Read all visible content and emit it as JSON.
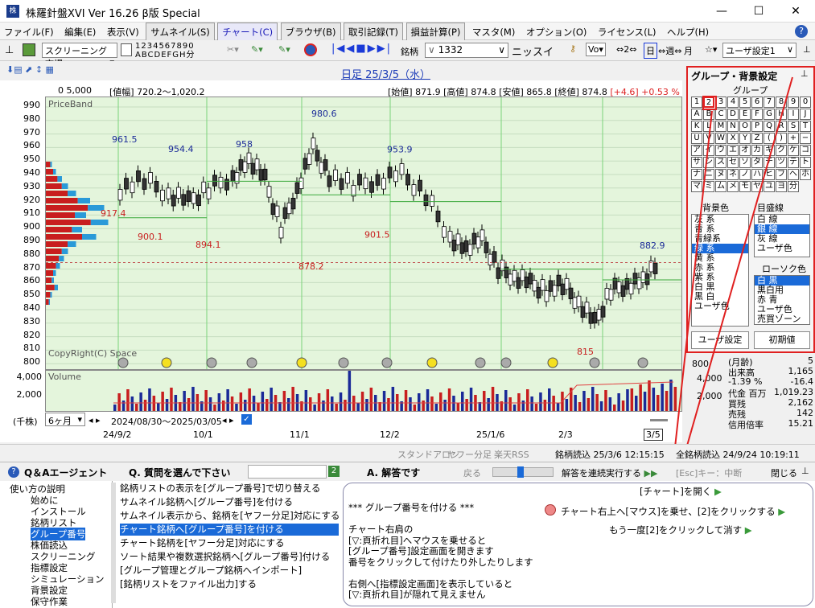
{
  "window": {
    "title": "株羅針盤XVI Ver 16.26 β版  Special",
    "icon": "app-icon"
  },
  "menu": [
    "ファイル(F)",
    "編集(E)",
    "表示(V)",
    "サムネイル(S)",
    "チャート(C)",
    "ブラウザ(B)",
    "取引記録(T)",
    "損益計算(P)",
    "マスタ(M)",
    "オプション(O)",
    "ライセンス(L)",
    "ヘルプ(H)"
  ],
  "toolbar": {
    "screening_combo": "スクリーニング市場",
    "digits_top": "1234567890",
    "digits_bottom": "ABCDEFGH分",
    "stock_label": "銘柄",
    "code": "1332",
    "name": "ニッスイ",
    "vo": "Vo",
    "two": "2",
    "day": "日",
    "week": "週",
    "month": "月",
    "user_setting": "ユーザ設定1"
  },
  "chart": {
    "date_title": "日足 25/3/5（水）",
    "scale_label": "0    5,000",
    "range_text": "[値幅] 720.2～1,020.2",
    "ohlc": {
      "open_label": "[始値]",
      "open": "871.9",
      "high_label": "[高値]",
      "high": "874.8",
      "low_label": "[安値]",
      "low": "865.8",
      "close_label": "[終値]",
      "close": "874.8",
      "change": "[+4.6]",
      "change_pct": "+0.53 %"
    },
    "price_band": "PriceBand",
    "copyright": "CopyRight(C) Space",
    "volume_label": "Volume",
    "unit_label": "(千株)",
    "period": "6ヶ月",
    "period_range": "2024/08/30～2025/03/05",
    "y_ticks": [
      "990",
      "980",
      "970",
      "960",
      "950",
      "940",
      "930",
      "920",
      "910",
      "900",
      "890",
      "880",
      "870",
      "860",
      "850",
      "840",
      "830",
      "820",
      "810",
      "800"
    ],
    "vol_ticks": [
      "4,000",
      "2,000"
    ],
    "x_ticks": [
      "24/9/2",
      "10/1",
      "11/1",
      "12/2",
      "25/1/6",
      "2/3",
      "3/5"
    ],
    "annotations_high": [
      "961.5",
      "954.4",
      "958",
      "980.6",
      "953.9",
      "882.9"
    ],
    "annotations_low": [
      "917.4",
      "900.1",
      "894.1",
      "878.2",
      "901.5",
      "815"
    ]
  },
  "group_panel": {
    "title": "グループ・背景設定",
    "group_label": "グループ",
    "grid": [
      [
        "1",
        "2",
        "3",
        "4",
        "5",
        "6",
        "7",
        "8",
        "9",
        "0"
      ],
      [
        "A",
        "B",
        "C",
        "D",
        "E",
        "F",
        "G",
        "H",
        "I",
        "J"
      ],
      [
        "K",
        "L",
        "M",
        "N",
        "O",
        "P",
        "Q",
        "R",
        "S",
        "T"
      ],
      [
        "U",
        "V",
        "W",
        "X",
        "Y",
        "Z",
        "(",
        ")",
        "+",
        "−"
      ],
      [
        "ア",
        "イ",
        "ウ",
        "エ",
        "オ",
        "カ",
        "キ",
        "ク",
        "ケ",
        "コ"
      ],
      [
        "サ",
        "シ",
        "ス",
        "セ",
        "ソ",
        "タ",
        "チ",
        "ツ",
        "テ",
        "ト"
      ],
      [
        "ナ",
        "ニ",
        "ヌ",
        "ネ",
        "ノ",
        "ハ",
        "ヒ",
        "フ",
        "ヘ",
        "ホ"
      ],
      [
        "マ",
        "ミ",
        "ム",
        "メ",
        "モ",
        "ヤ",
        "ユ",
        "ヨ",
        "分",
        ""
      ]
    ],
    "bg_label": "背景色",
    "bg_options": [
      "灰 系",
      "青 系",
      "青緑系",
      "緑 系",
      "黄 系",
      "赤 系",
      "紫 系",
      "白 黒",
      "黒 白",
      "ユーザ色"
    ],
    "bg_selected": "緑 系",
    "grid_label": "目盛線",
    "grid_options": [
      "白 線",
      "銀 線",
      "灰 線",
      "ユーザ色"
    ],
    "grid_selected": "銀 線",
    "candle_label": "ローソク色",
    "candle_options": [
      "白 黒",
      "黒白用",
      "赤 青",
      "ユーザ色",
      "売買ゾーン"
    ],
    "candle_selected": "白 黒",
    "user_btn": "ユーザ設定",
    "reset_btn": "初期値"
  },
  "stats": [
    [
      "(月齢)",
      "5"
    ],
    [
      "出来高",
      "1,165"
    ],
    [
      "-1.39 %",
      "-16.4"
    ],
    [
      "代金 百万",
      "1,019.23"
    ],
    [
      "買残",
      "2,162"
    ],
    [
      "売残",
      "142"
    ],
    [
      "信用倍率",
      "15.21"
    ]
  ],
  "right_axis": [
    "800",
    "4,000",
    "2,000"
  ],
  "status": {
    "standalone": "スタンドアロン",
    "yahoo": "ヤフー分足",
    "rakuten": "楽天RSS",
    "read": "銘柄読込 25/3/6 12:15:15",
    "all_read": "全銘柄読込 24/9/24 10:19:11"
  },
  "qa": {
    "title": "Q＆Aエージェント",
    "question_prompt": "Q. 質問を選んで下さい",
    "answer_title": "A. 解答です",
    "back": "戻る",
    "continuous": "解答を連続実行する",
    "esc": "[Esc]キー：中断",
    "close": "閉じる"
  },
  "tree": [
    "使い方の説明",
    "始めに",
    "インストール",
    "銘柄リスト",
    "グループ番号",
    "株価読込",
    "スクリーニング",
    "指標設定",
    "シミュレーション",
    "背景設定",
    "保守作業"
  ],
  "questions": [
    "銘柄リストの表示を[グループ番号]で切り替える",
    "サムネイル銘柄へ[グループ番号]を付ける",
    "サムネイル表示から、銘柄を[ヤフー分足]対応にする",
    "チャート銘柄へ[グループ番号]を付ける",
    "チャート銘柄を[ヤフー分足]対応にする",
    "ソート結果や複数選択銘柄へ[グループ番号]付ける",
    "[グループ管理とグループ銘柄へインポート]",
    "[銘柄リストをファイル出力]する"
  ],
  "answer": {
    "steps": [
      "[チャート]を開く",
      "チャート右上へ[マウス]を乗せ、[2]をクリックする",
      "もう一度[2]をクリックして消す"
    ],
    "body": [
      "*** グループ番号を付ける ***",
      "",
      "チャート右肩の",
      "[▽:頁折れ目]へマウスを乗せると",
      "[グループ番号]設定画面を開きます",
      "番号をクリックして付けたり外したりします",
      "",
      "右側へ[指標設定画面]を表示していると",
      "[▽:頁折れ目]が隠れて見えません"
    ]
  },
  "colors": {
    "accent": "#e02020",
    "chart_bg": "#e4f5dc",
    "selected": "#1a6ad8"
  }
}
